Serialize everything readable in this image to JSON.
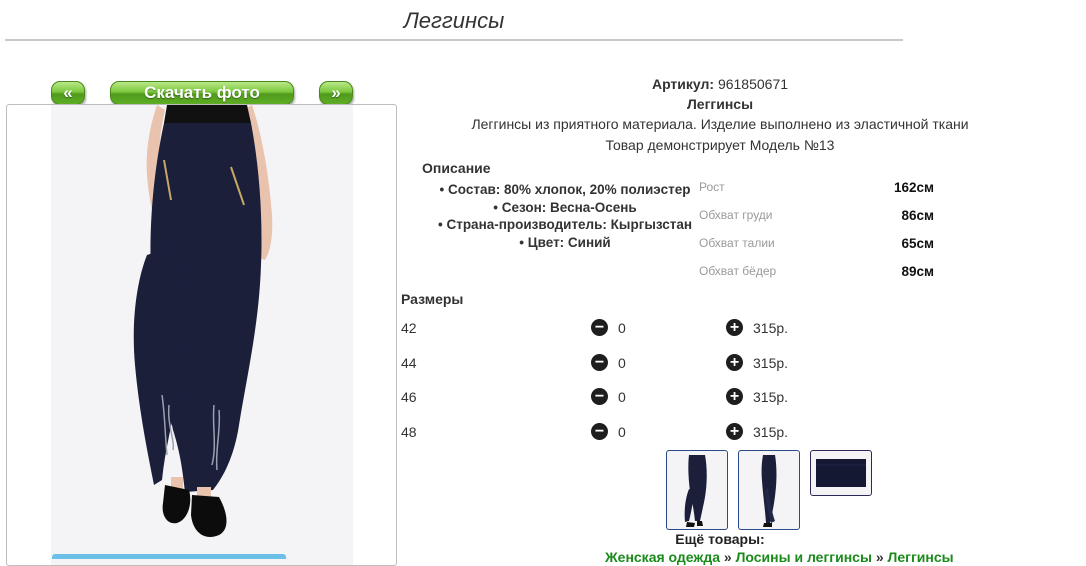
{
  "page": {
    "title": "Леггинсы"
  },
  "gallery": {
    "prev_label": "«",
    "download_label": "Скачать фото",
    "next_label": "»",
    "thumbnails": [
      "product-photo-front",
      "product-photo-side",
      "fabric-swatch-navy"
    ]
  },
  "product": {
    "article_label": "Артикул:",
    "article": "961850671",
    "name": "Леггинсы",
    "summary": "Леггинсы из приятного материала. Изделие выполнено из эластичной ткани",
    "model_note": "Товар демонстрирует Модель №13",
    "description_title": "Описание",
    "description": [
      "Состав: 80% хлопок, 20% полиэстер",
      "Сезон: Весна-Осень",
      "Страна-производитель: Кыргызстан",
      "Цвет: Синий"
    ]
  },
  "model_measurements": [
    {
      "label": "Рост",
      "value": "162см"
    },
    {
      "label": "Обхват груди",
      "value": "86см"
    },
    {
      "label": "Обхват талии",
      "value": "65см"
    },
    {
      "label": "Обхват бёдер",
      "value": "89см"
    }
  ],
  "sizes": {
    "title": "Размеры",
    "rows": [
      {
        "size": "42",
        "qty": "0",
        "price": "315р."
      },
      {
        "size": "44",
        "qty": "0",
        "price": "315р."
      },
      {
        "size": "46",
        "qty": "0",
        "price": "315р."
      },
      {
        "size": "48",
        "qty": "0",
        "price": "315р."
      }
    ],
    "minus_icon": "−",
    "plus_icon": "+"
  },
  "more": {
    "title": "Ещё товары:",
    "breadcrumb": [
      "Женская одежда",
      "Лосины и леггинсы",
      "Леггинсы"
    ],
    "separator": "»"
  },
  "colors": {
    "accent_green": "#5fae25",
    "link_green": "#1a8a1a",
    "garment_navy": "#1b1f3a"
  }
}
